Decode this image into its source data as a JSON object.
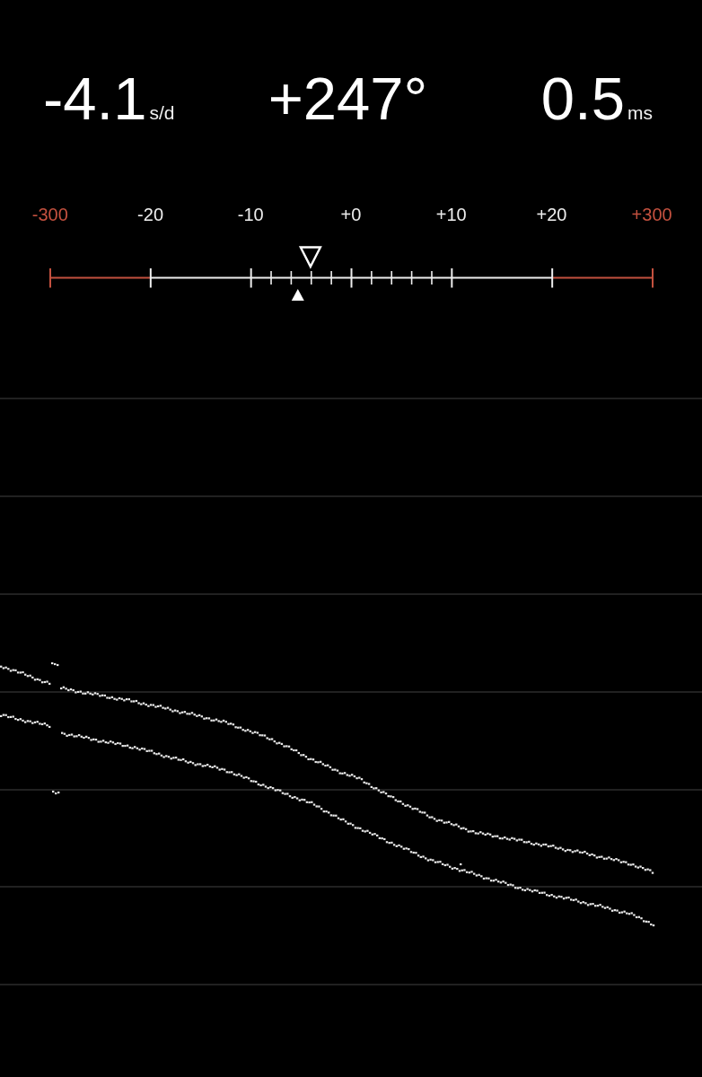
{
  "readings": [
    {
      "value": "-4.1",
      "unit": "s/d"
    },
    {
      "value": "+247°"
    },
    {
      "value": "0.5",
      "unit": "ms"
    }
  ],
  "scale": {
    "labels": [
      {
        "text": "-300",
        "color": "#c4513f"
      },
      {
        "text": "-20",
        "color": "#eeeeee"
      },
      {
        "text": "-10",
        "color": "#eeeeee"
      },
      {
        "text": "+0",
        "color": "#eeeeee"
      },
      {
        "text": "+10",
        "color": "#eeeeee"
      },
      {
        "text": "+20",
        "color": "#eeeeee"
      },
      {
        "text": "+300",
        "color": "#c4513f"
      }
    ],
    "segments": [
      {
        "kind": "plain",
        "color": "#c4513f"
      },
      {
        "kind": "plain",
        "color": "#eeeeee"
      },
      {
        "kind": "fine",
        "color": "#eeeeee"
      },
      {
        "kind": "fine",
        "color": "#eeeeee"
      },
      {
        "kind": "plain",
        "color": "#eeeeee"
      },
      {
        "kind": "plain",
        "color": "#c4513f"
      }
    ],
    "markers": [
      {
        "kind": "hollow",
        "level": 0.432
      },
      {
        "kind": "solid",
        "level": 0.411
      }
    ]
  },
  "trace_plot": {
    "kind": "dots"
  }
}
